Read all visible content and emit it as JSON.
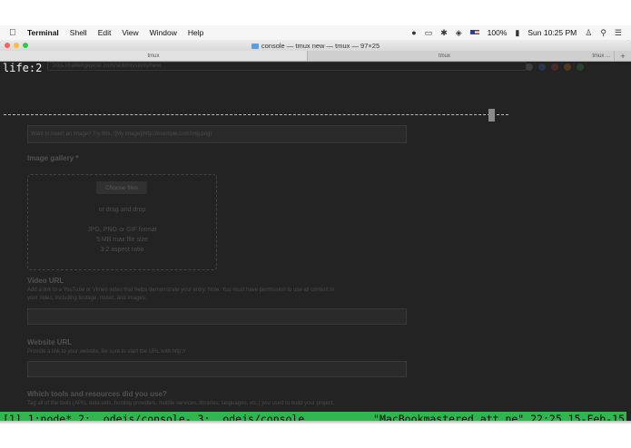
{
  "menubar": {
    "app": "Terminal",
    "items": [
      "Shell",
      "Edit",
      "View",
      "Window",
      "Help"
    ],
    "battery": "100%",
    "clock": "Sun 10:25 PM"
  },
  "window": {
    "title": "console — tmux new — tmux — 97×25",
    "tabs": [
      "tmux",
      "tmux",
      "tmux ...",
      "+"
    ]
  },
  "terminal": {
    "prompt": "life:2"
  },
  "ghost": {
    "url": "20js.challengepost.com/submissions/new",
    "hint_image": "Want to insert an image? Try this: ![My image](http://example.com/img.png)",
    "image_gallery": "Image gallery *",
    "choose_files": "Choose files",
    "drag_drop": "or drag and drop",
    "formats": "JPG, PNG or GIF format",
    "max_size": "5 MB max file size",
    "aspect": "3:2 aspect ratio",
    "video_url": "Video URL",
    "video_hint_1": "Add a link to a YouTube or Vimeo video that helps demonstrate your entry. Note: You must have permission to use all content in",
    "video_hint_2": "your video, including footage, music, and images.",
    "website_url": "Website URL",
    "website_hint": "Provide a link to your website. Be sure to start the URL with http://",
    "tools": "Which tools and resources did you use?",
    "tools_hint": "Tag all of the tools (APIs, data sets, hosting providers, mobile services, libraries, languages, etc.) you used to build your project."
  },
  "status_bar": {
    "left": "[1] 1:node* 2:..odejs/console- 3:..odejs/console",
    "right": "\"MacBookmastered.att.ne\" 22:25 15-Feb-15"
  },
  "colors": {
    "status_green": "#2fb64f",
    "terminal_bg": "#232323"
  }
}
